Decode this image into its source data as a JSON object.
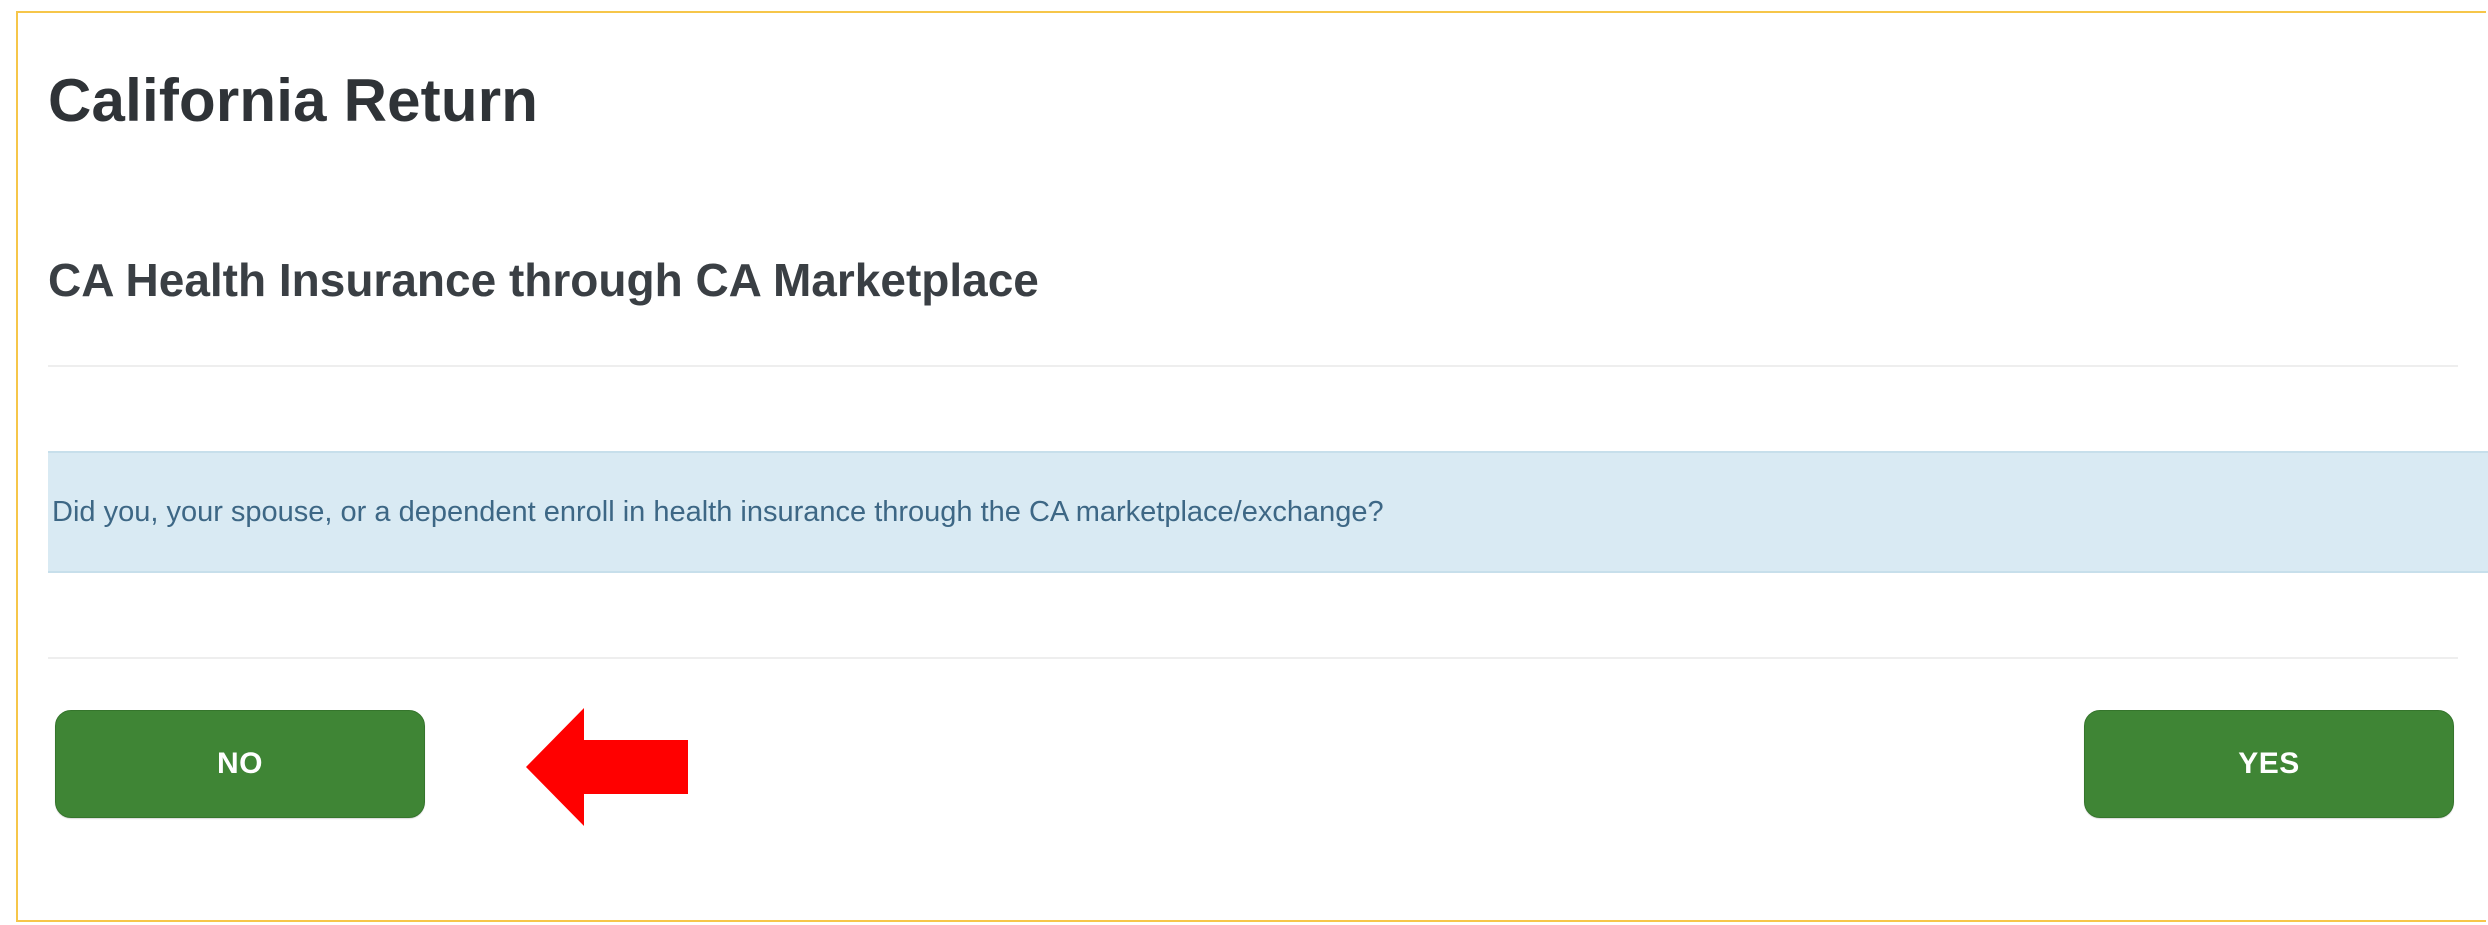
{
  "header": {
    "title": "California Return"
  },
  "section": {
    "title": "CA Health Insurance through CA Marketplace"
  },
  "question": {
    "text": "Did you, your spouse, or a dependent enroll in health insurance through the CA marketplace/exchange?"
  },
  "buttons": {
    "no_label": "NO",
    "yes_label": "YES"
  },
  "colors": {
    "frame_border": "#f6c64a",
    "button_green": "#3f8535",
    "question_bg": "#d9eaf3",
    "arrow_red": "#ff0000"
  },
  "annotation": {
    "icon": "left-arrow-icon"
  }
}
